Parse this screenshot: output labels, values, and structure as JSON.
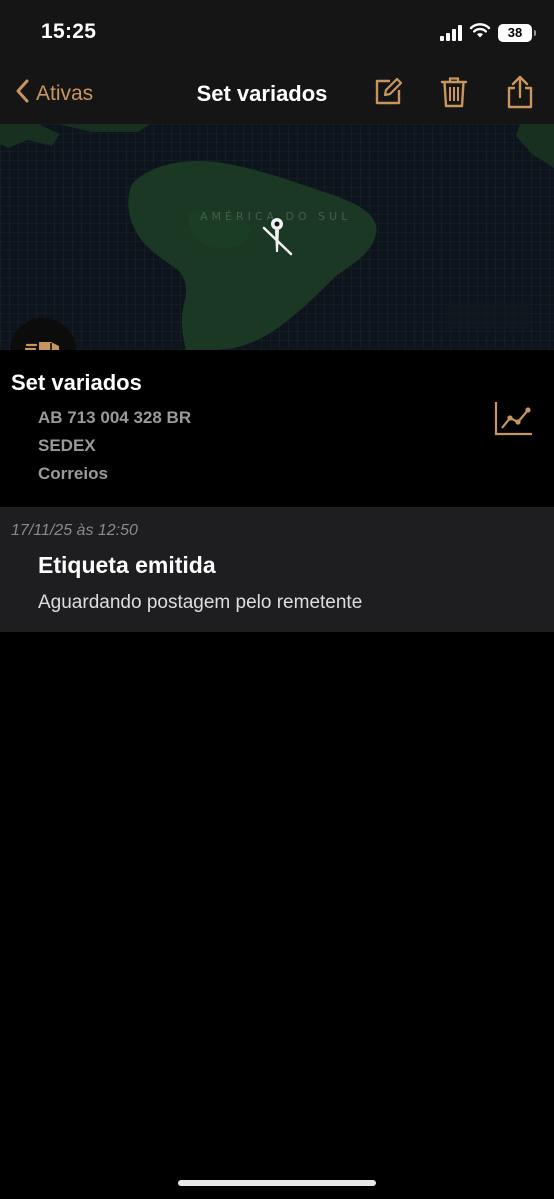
{
  "status_bar": {
    "time": "15:25",
    "battery": "38",
    "icons": [
      "signal-icon",
      "wifi-icon",
      "battery-icon"
    ]
  },
  "nav": {
    "back_label": "Ativas",
    "title": "Set variados",
    "actions": [
      "edit-icon",
      "trash-icon",
      "share-icon"
    ],
    "accent_color": "#c8955f"
  },
  "map": {
    "label": "AMÉRICA DO SUL"
  },
  "package": {
    "title": "Set variados",
    "tracking_code": "AB 713 004 328 BR",
    "service": "SEDEX",
    "carrier": "Correios"
  },
  "events": [
    {
      "date": "17/11/25 às 12:50",
      "title": "Etiqueta emitida",
      "description": "Aguardando postagem pelo remetente"
    }
  ]
}
